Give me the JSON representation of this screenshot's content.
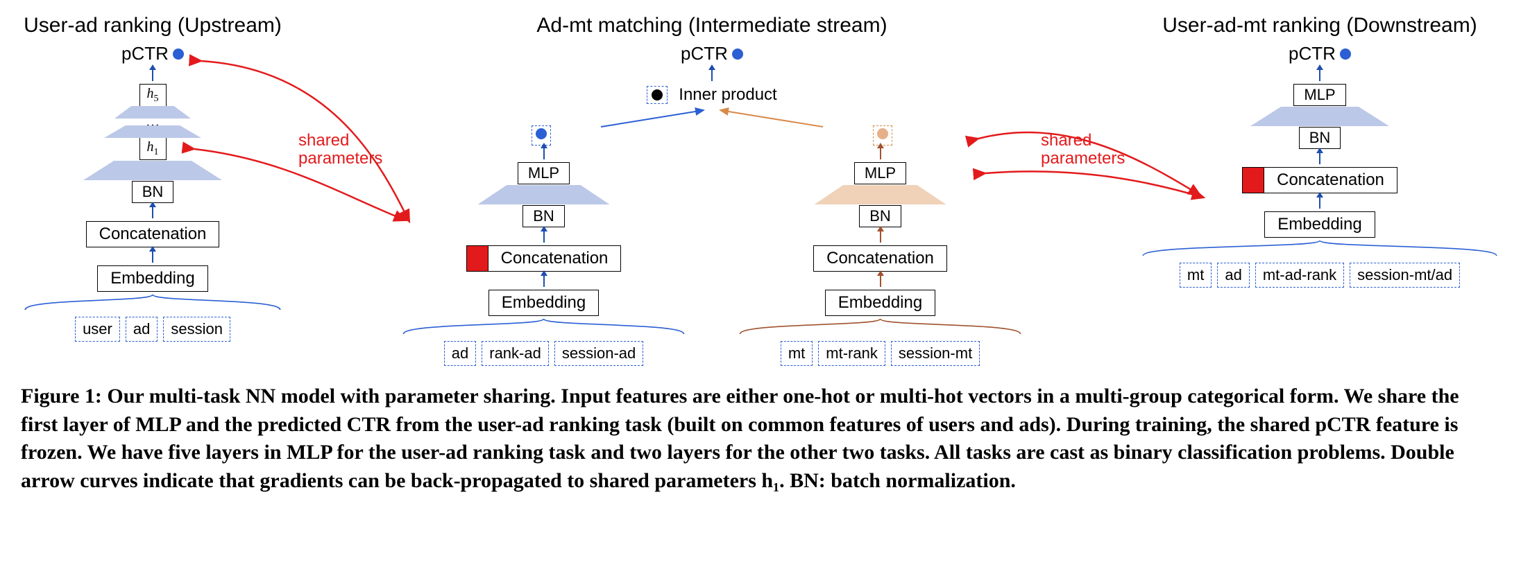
{
  "streams": {
    "upstream": {
      "title": "User-ad ranking (Upstream)",
      "pctr": "pCTR",
      "h5": "h",
      "h5_sub": "5",
      "ellipsis": "…",
      "h1": "h",
      "h1_sub": "1",
      "bn": "BN",
      "concat": "Concatenation",
      "embed": "Embedding",
      "inputs": [
        "user",
        "ad",
        "session"
      ]
    },
    "intermediate": {
      "title": "Ad-mt matching (Intermediate stream)",
      "pctr": "pCTR",
      "inner_product": "Inner product",
      "left": {
        "mlp": "MLP",
        "bn": "BN",
        "concat": "Concatenation",
        "embed": "Embedding",
        "inputs": [
          "ad",
          "rank-ad",
          "session-ad"
        ]
      },
      "right": {
        "mlp": "MLP",
        "bn": "BN",
        "concat": "Concatenation",
        "embed": "Embedding",
        "inputs": [
          "mt",
          "mt-rank",
          "session-mt"
        ]
      }
    },
    "downstream": {
      "title": "User-ad-mt ranking (Downstream)",
      "pctr": "pCTR",
      "mlp": "MLP",
      "bn": "BN",
      "concat": "Concatenation",
      "embed": "Embedding",
      "inputs": [
        "mt",
        "ad",
        "mt-ad-rank",
        "session-mt/ad"
      ]
    }
  },
  "shared_left": "shared\nparameters",
  "shared_right": "shared\nparameters",
  "caption": "Figure 1: Our multi-task NN model with parameter sharing. Input features are either one-hot or multi-hot vectors in a multi-group categorical form. We share the first layer of MLP and the predicted CTR from the user-ad ranking task (built on common features of users and ads). During training, the shared pCTR feature is frozen. We have five layers in MLP for the user-ad ranking task and two layers for the other two tasks. All tasks are cast as binary classification problems. Double arrow curves indicate that gradients can be back-propagated to shared parameters h₁. BN: batch normalization."
}
